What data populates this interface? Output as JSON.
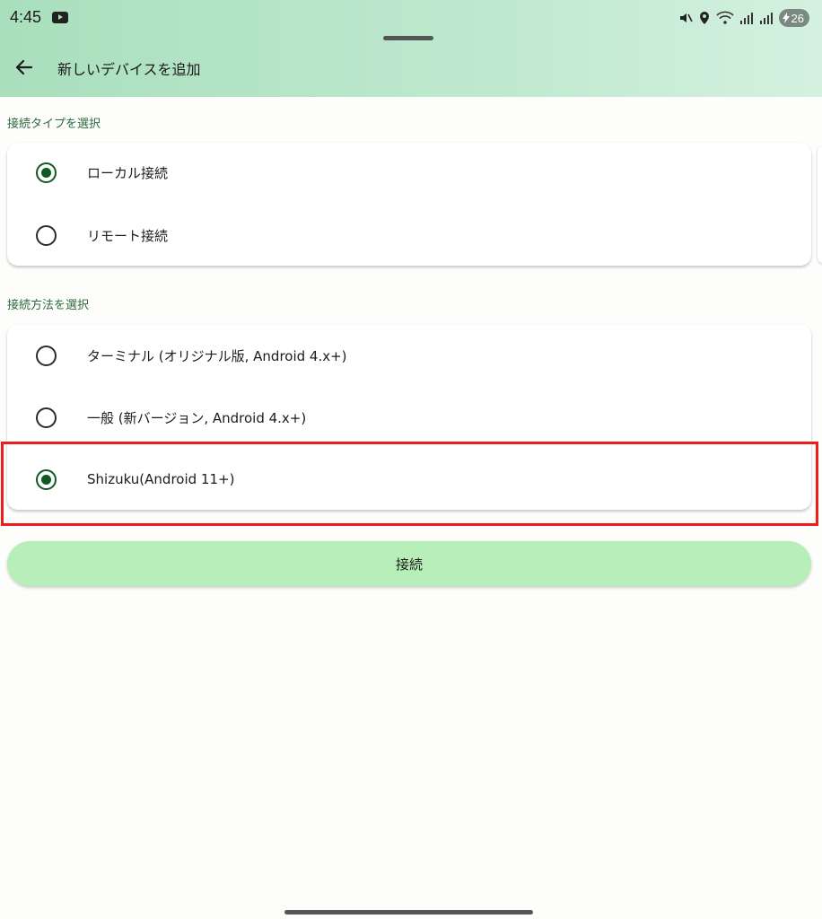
{
  "status_bar": {
    "time": "4:45",
    "battery": "26",
    "icons": [
      "youtube-icon",
      "mute-icon",
      "location-icon",
      "wifi-icon",
      "signal-icon",
      "signal-icon",
      "battery-charging-icon"
    ]
  },
  "header": {
    "title": "新しいデバイスを追加"
  },
  "connection_type": {
    "label": "接続タイプを選択",
    "options": [
      {
        "label": "ローカル接続",
        "selected": true
      },
      {
        "label": "リモート接続",
        "selected": false
      }
    ]
  },
  "connection_method": {
    "label": "接続方法を選択",
    "options": [
      {
        "label": "ターミナル (オリジナル版, Android 4.x+)",
        "selected": false
      },
      {
        "label": "一般 (新バージョン, Android 4.x+)",
        "selected": false
      },
      {
        "label": "Shizuku(Android 11+)",
        "selected": true
      }
    ]
  },
  "connect_button": {
    "label": "接続"
  },
  "colors": {
    "header_gradient_start": "#a9dfbd",
    "header_gradient_end": "#d4f1df",
    "accent": "#0f5a22",
    "button_bg": "#b8eeb8",
    "highlight": "#ee1c1c"
  }
}
